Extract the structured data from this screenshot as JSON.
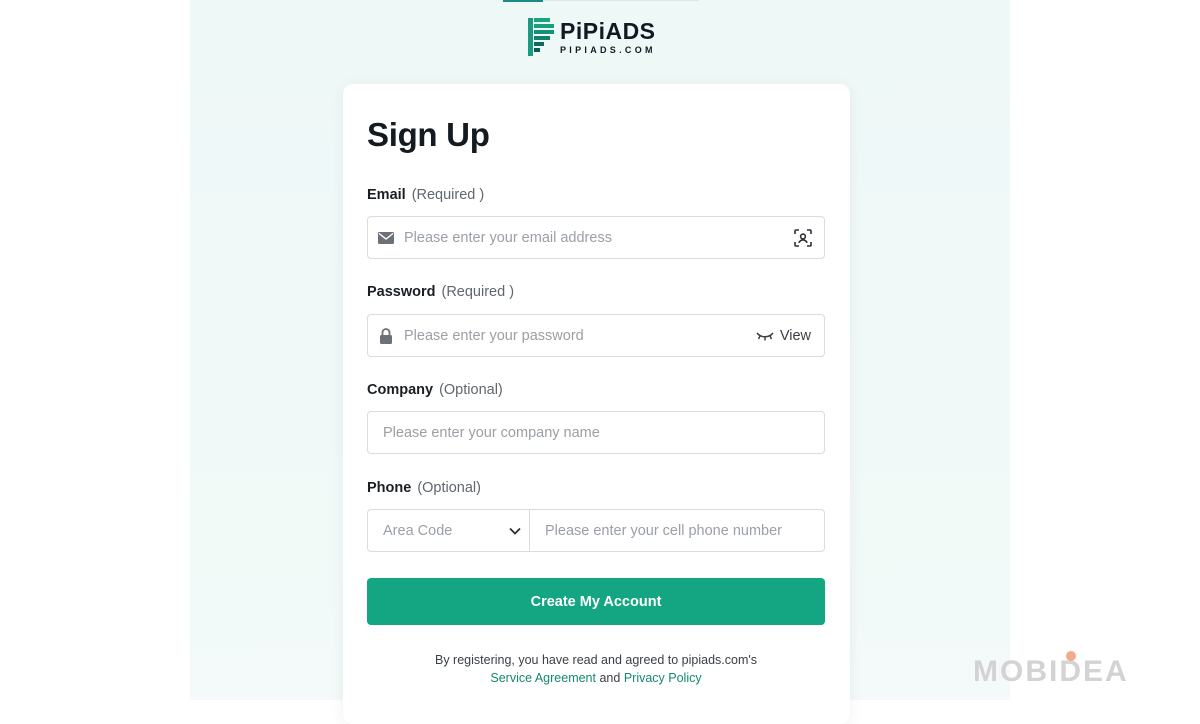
{
  "brand": {
    "name": "PiPiADS",
    "domain": "PIPIADS.COM",
    "accent_color": "#14a583"
  },
  "form": {
    "title": "Sign Up",
    "email": {
      "label": "Email",
      "hint": "(Required )",
      "placeholder": "Please enter your email address",
      "icon": "envelope-icon",
      "action_icon": "face-scan-icon"
    },
    "password": {
      "label": "Password",
      "hint": "(Required )",
      "placeholder": "Please enter your password",
      "icon": "lock-icon",
      "toggle_label": "View",
      "toggle_icon": "eye-closed-icon"
    },
    "company": {
      "label": "Company",
      "hint": "(Optional)",
      "placeholder": "Please enter your company name"
    },
    "phone": {
      "label": "Phone",
      "hint": "(Optional)",
      "area_code_placeholder": "Area Code",
      "placeholder": "Please enter your cell phone number",
      "dropdown_icon": "chevron-down-icon"
    },
    "submit_label": "Create My Account",
    "terms": {
      "prefix": "By registering, you have read and agreed to pipiads.com's",
      "service_link": "Service Agreement",
      "conjunction": "and",
      "privacy_link": "Privacy Policy"
    }
  },
  "watermark": {
    "text": "MOBIDEA"
  }
}
